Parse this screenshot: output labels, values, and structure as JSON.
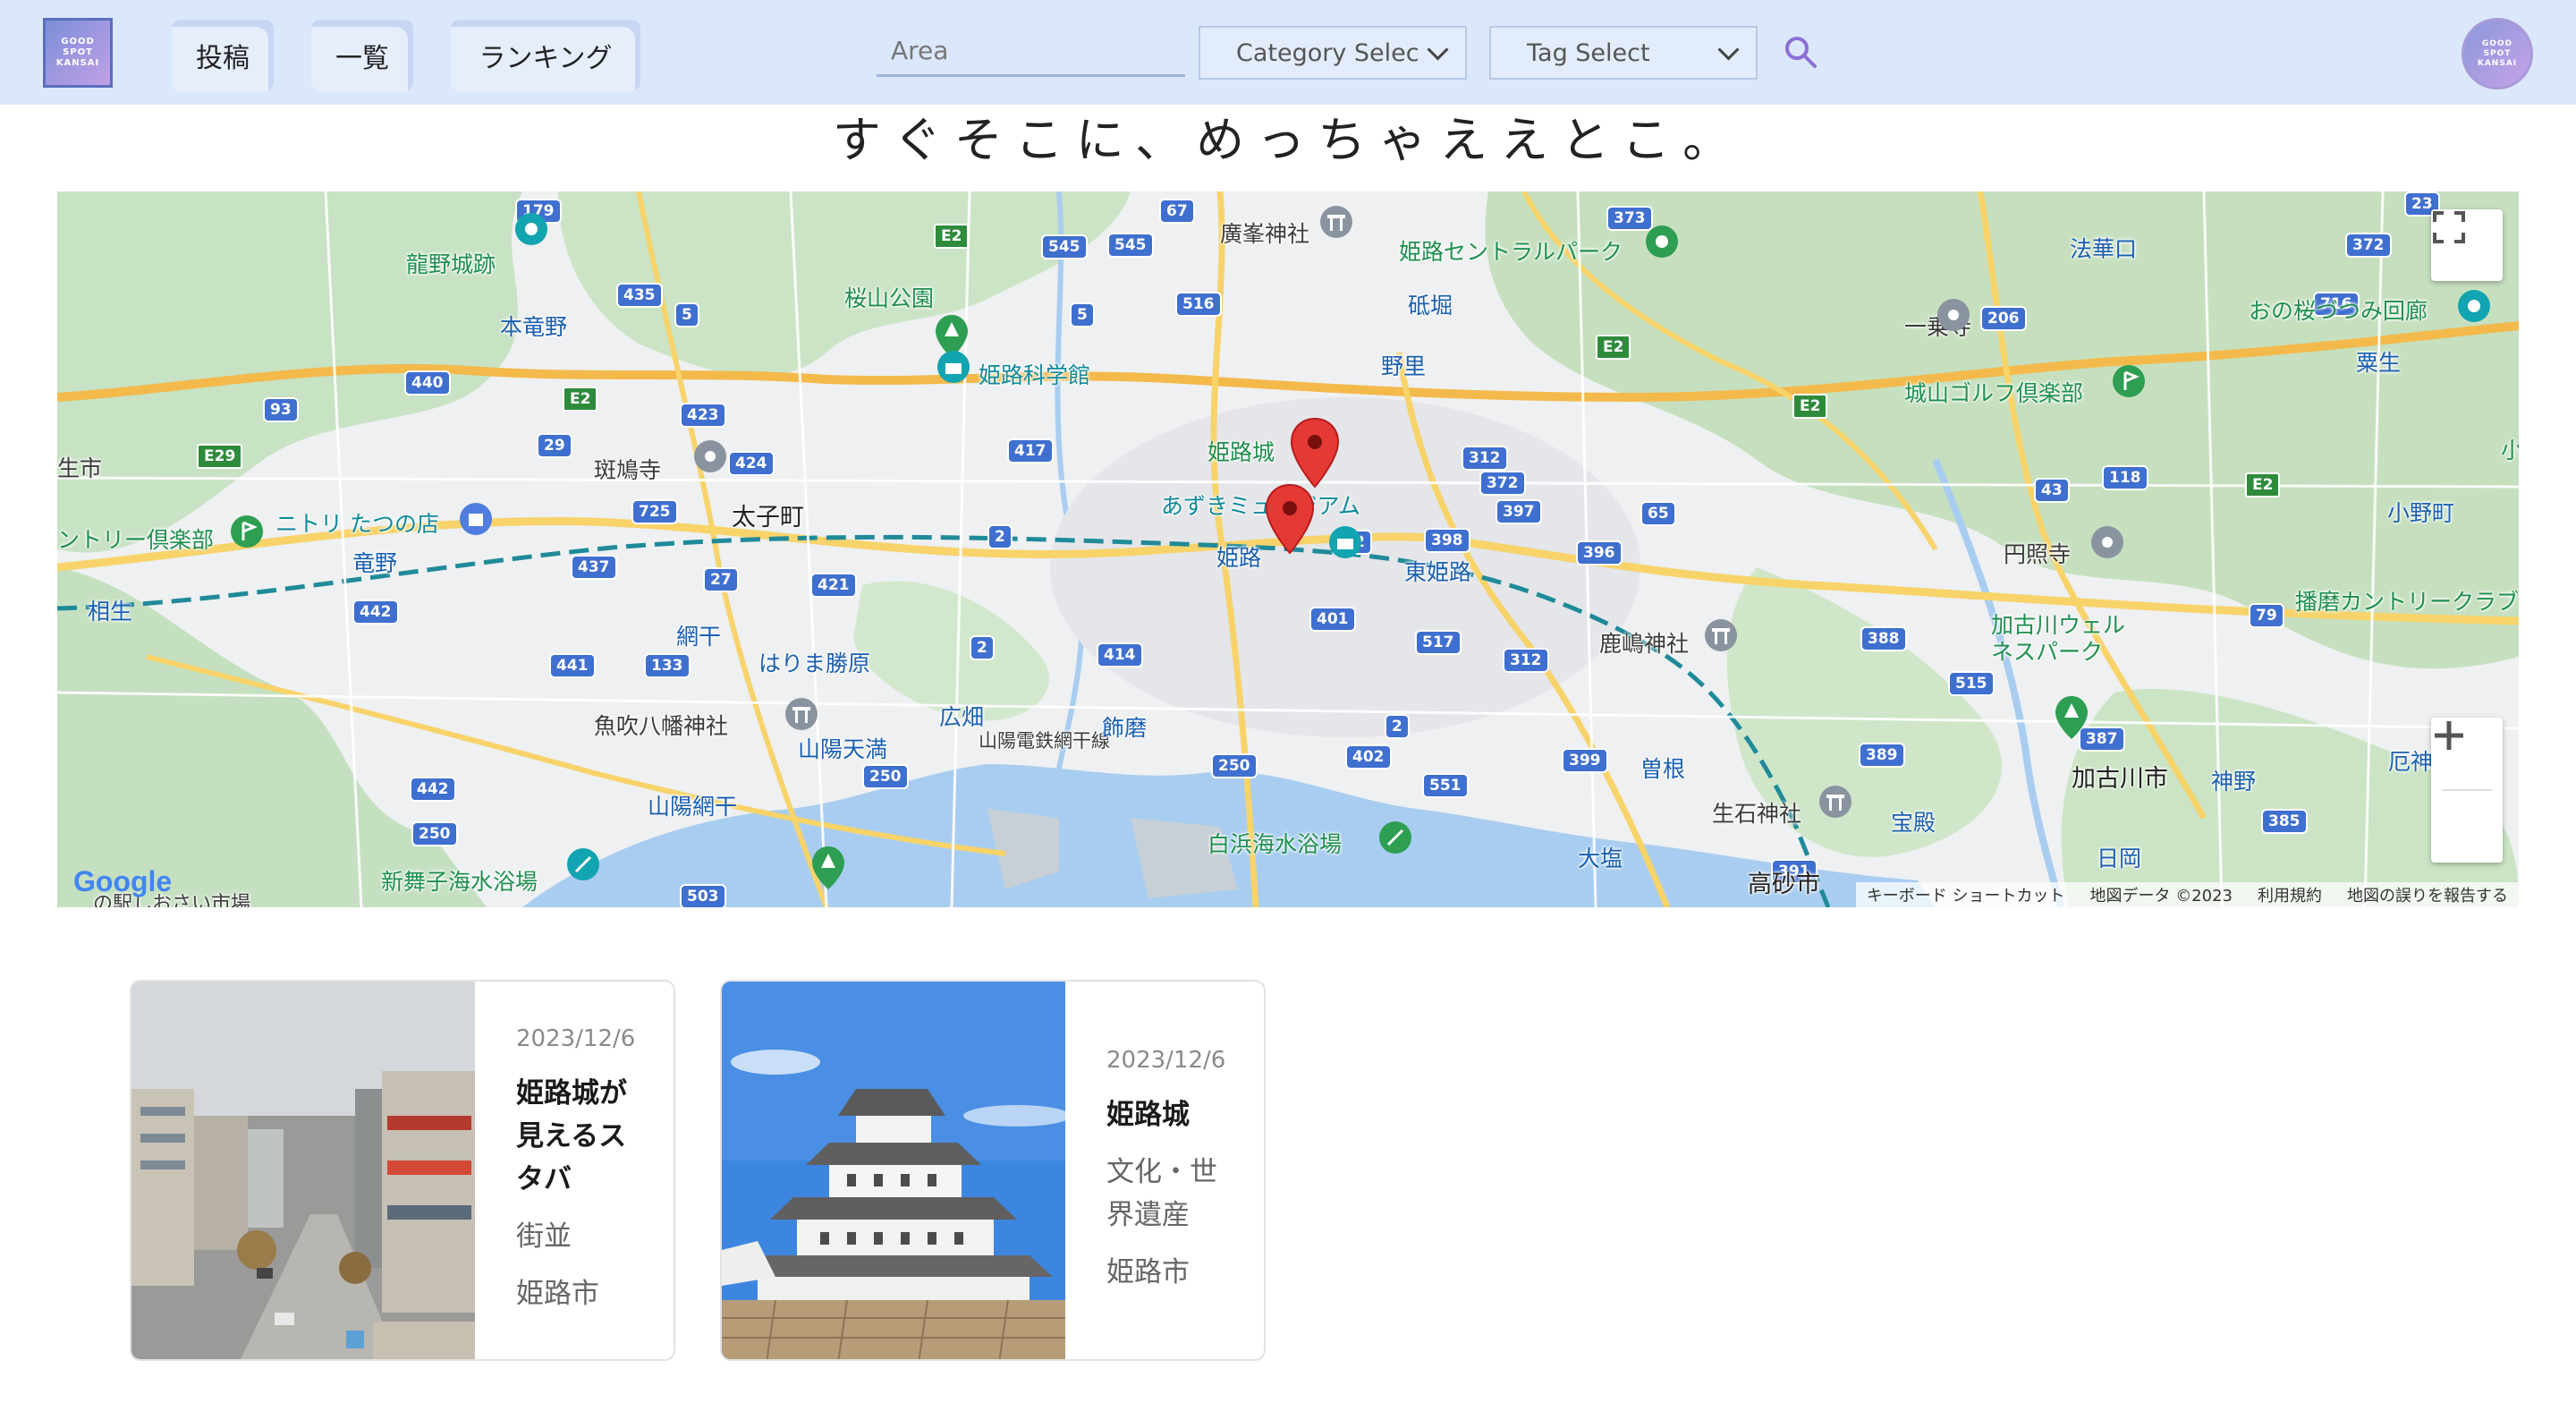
{
  "header": {
    "logo_lines": [
      "GOOD",
      "SPOT",
      "KANSAI"
    ],
    "nav": [
      {
        "label": "投稿"
      },
      {
        "label": "一覧"
      },
      {
        "label": "ランキング"
      }
    ],
    "area_placeholder": "Area",
    "category_select": "Category Select",
    "tag_select": "Tag Select",
    "avatar_lines": [
      "GOOD",
      "SPOT",
      "KANSAI"
    ]
  },
  "tagline": "すぐそこに、めっちゃええとこ。",
  "map": {
    "labels": {
      "kakuho": "廣峯神社",
      "himeji_central_park": "姫路セントラルパーク",
      "hokkeguchi": "法華口",
      "tatsuno_castle": "龍野城跡",
      "sakurayama_park": "桜山公園",
      "hon_tatsuno": "本竜野",
      "himeji_science": "姫路科学館",
      "nozato": "野里",
      "shikaba": "砥堀",
      "ichijoji": "一乗寺",
      "onozakura": "おの桜づつみ回廊",
      "awao": "粟生",
      "shiroyama_golf": "城山ゴルフ倶楽部",
      "himeji_castle": "姫路城",
      "ikarugaji": "斑鳩寺",
      "taishi": "太子町",
      "azuki_museum": "あずきミュージアム",
      "nitori": "ニトリ たつの店",
      "country_club_left": "ントリー倶楽部",
      "tatsuno": "竜野",
      "himeji_station": "姫路",
      "higashi_himeji": "東姫路",
      "enshoji": "円照寺",
      "onoda": "小野町",
      "aioi": "相生",
      "aboshi": "網干",
      "harima_katsuhara": "はりま勝原",
      "kashima_shrine": "鹿嶋神社",
      "kakogawa_wellness": "加古川ウェルネスパーク",
      "banshu_cc": "播磨カントリークラブ",
      "uoshiki_shrine": "魚吹八幡神社",
      "hirohata": "広畑",
      "sanyo_line": "山陽電鉄網干線",
      "shikama": "飾磨",
      "sanyo_tenma": "山陽天満",
      "sone": "曽根",
      "kakogawa_city": "加古川市",
      "kanno": "神野",
      "sanyo_aboshi": "山陽網干",
      "shiraha_beach": "白浜海水浴場",
      "ishinohoden": "生石神社",
      "hoden": "宝殿",
      "oshio": "大塩",
      "niomaiko": "新舞子海水浴場",
      "takasago": "高砂市",
      "hioka": "日岡",
      "tokise": "厄神",
      "city_left": "生市",
      "small_right": "小"
    },
    "roads": [
      "179",
      "67",
      "373",
      "23",
      "545",
      "545",
      "E2",
      "372",
      "435",
      "5",
      "516",
      "5",
      "716",
      "440",
      "93",
      "E2",
      "423",
      "206",
      "29",
      "424",
      "E29",
      "417",
      "725",
      "312",
      "E2",
      "E2",
      "2",
      "372",
      "43",
      "118",
      "E2",
      "397",
      "65",
      "396",
      "437",
      "27",
      "421",
      "2",
      "398",
      "2",
      "442",
      "401",
      "517",
      "388",
      "79",
      "441",
      "133",
      "414",
      "312",
      "515",
      "2",
      "387",
      "442",
      "402",
      "389",
      "250",
      "250",
      "399",
      "551",
      "385",
      "250",
      "391",
      "503"
    ],
    "attribution": [
      "キーボード ショートカット",
      "地図データ ©2023",
      "利用規約",
      "地図の誤りを報告する"
    ],
    "google": "Google",
    "bottom_left": "の駅しおさい市場"
  },
  "posts": [
    {
      "date": "2023/12/6",
      "title": "姫路城が見えるスタバ",
      "category": "街並",
      "city": "姫路市"
    },
    {
      "date": "2023/12/6",
      "title": "姫路城",
      "category": "文化・世界遺産",
      "city": "姫路市"
    }
  ],
  "colors": {
    "header_bg": "#dbe7fb",
    "accent": "#8b6fd6",
    "pin": "#e53935"
  }
}
